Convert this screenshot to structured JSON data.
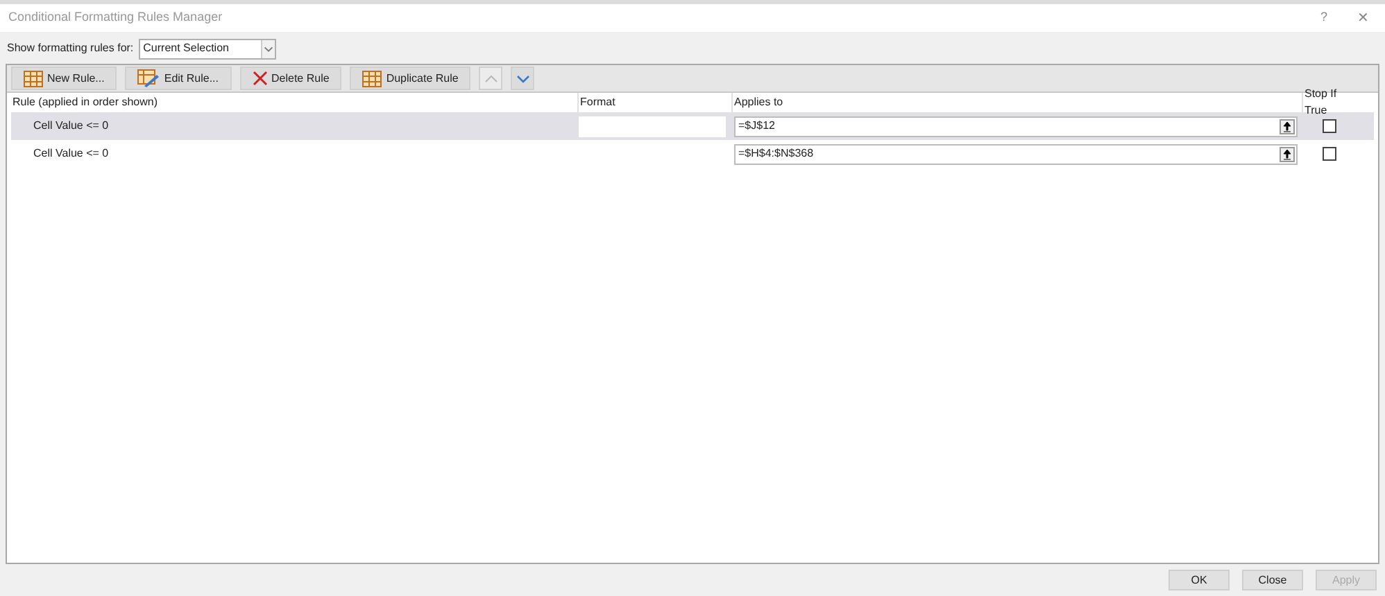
{
  "window": {
    "title": "Conditional Formatting Rules Manager",
    "help": "?",
    "close": "✕"
  },
  "show_rules": {
    "label": "Show formatting rules for:",
    "value": "Current Selection"
  },
  "toolbar": [
    {
      "kind": "new",
      "label": "New Rule...",
      "disabled": false
    },
    {
      "kind": "edit",
      "label": "Edit Rule...",
      "disabled": false
    },
    {
      "kind": "delete",
      "label": "Delete Rule",
      "disabled": false
    },
    {
      "kind": "duplicate",
      "label": "Duplicate Rule",
      "disabled": false
    },
    {
      "kind": "up",
      "disabled": true
    },
    {
      "kind": "down",
      "disabled": false
    }
  ],
  "table": {
    "columns": [
      "Rule (applied in order shown)",
      "Format",
      "Applies to",
      "Stop If True"
    ],
    "rows": [
      {
        "rule": "Cell Value <= 0",
        "applies_to": "=$J$12",
        "stop_if_true": false,
        "selected": true
      },
      {
        "rule": "Cell Value <= 0",
        "applies_to": "=$H$4:$N$368",
        "stop_if_true": false,
        "selected": false
      }
    ]
  },
  "buttons": [
    {
      "label": "OK",
      "disabled": false
    },
    {
      "label": "Close",
      "disabled": false
    },
    {
      "label": "Apply",
      "disabled": true
    }
  ]
}
